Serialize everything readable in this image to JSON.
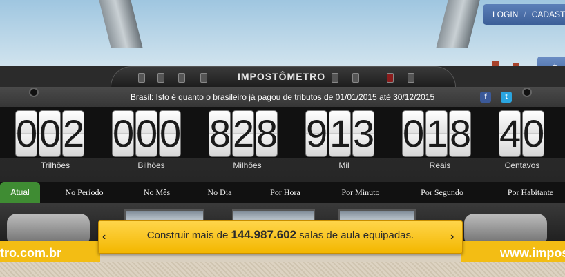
{
  "auth": {
    "login": "LOGIN",
    "separator": "/",
    "register": "CADAST"
  },
  "side_button": "+ O",
  "brand": "IMPOSTÔMETRO",
  "subtitle": "Brasil: Isto é quanto o brasileiro já pagou de tributos de 01/01/2015 até 30/12/2015",
  "social": {
    "facebook": "f",
    "twitter": "t"
  },
  "counter": {
    "groups": [
      {
        "digits": [
          "0",
          "0",
          "2"
        ],
        "label": "Trilhões"
      },
      {
        "digits": [
          "0",
          "0",
          "0"
        ],
        "label": "Bilhões"
      },
      {
        "digits": [
          "8",
          "2",
          "8"
        ],
        "label": "Milhões"
      },
      {
        "digits": [
          "9",
          "1",
          "3"
        ],
        "label": "Mil"
      },
      {
        "digits": [
          "0",
          "1",
          "8"
        ],
        "label": "Reais"
      },
      {
        "digits": [
          "4",
          "0"
        ],
        "label": "Centavos"
      }
    ]
  },
  "tabs": [
    "Atual",
    "No Período",
    "No Mês",
    "No Dia",
    "Por Hora",
    "Por Minuto",
    "Por Segundo",
    "Por Habitante"
  ],
  "active_tab": "Atual",
  "ticker": {
    "prefix": "Construir mais de",
    "value": "144.987.602",
    "suffix": "salas de aula equipadas.",
    "prev": "‹",
    "next": "›"
  },
  "site_left": "tro.com.br",
  "site_right": "www.impost",
  "colors": {
    "active_tab": "#3f8c33",
    "ticker": "#f3b700",
    "login": "#3c5f98"
  }
}
